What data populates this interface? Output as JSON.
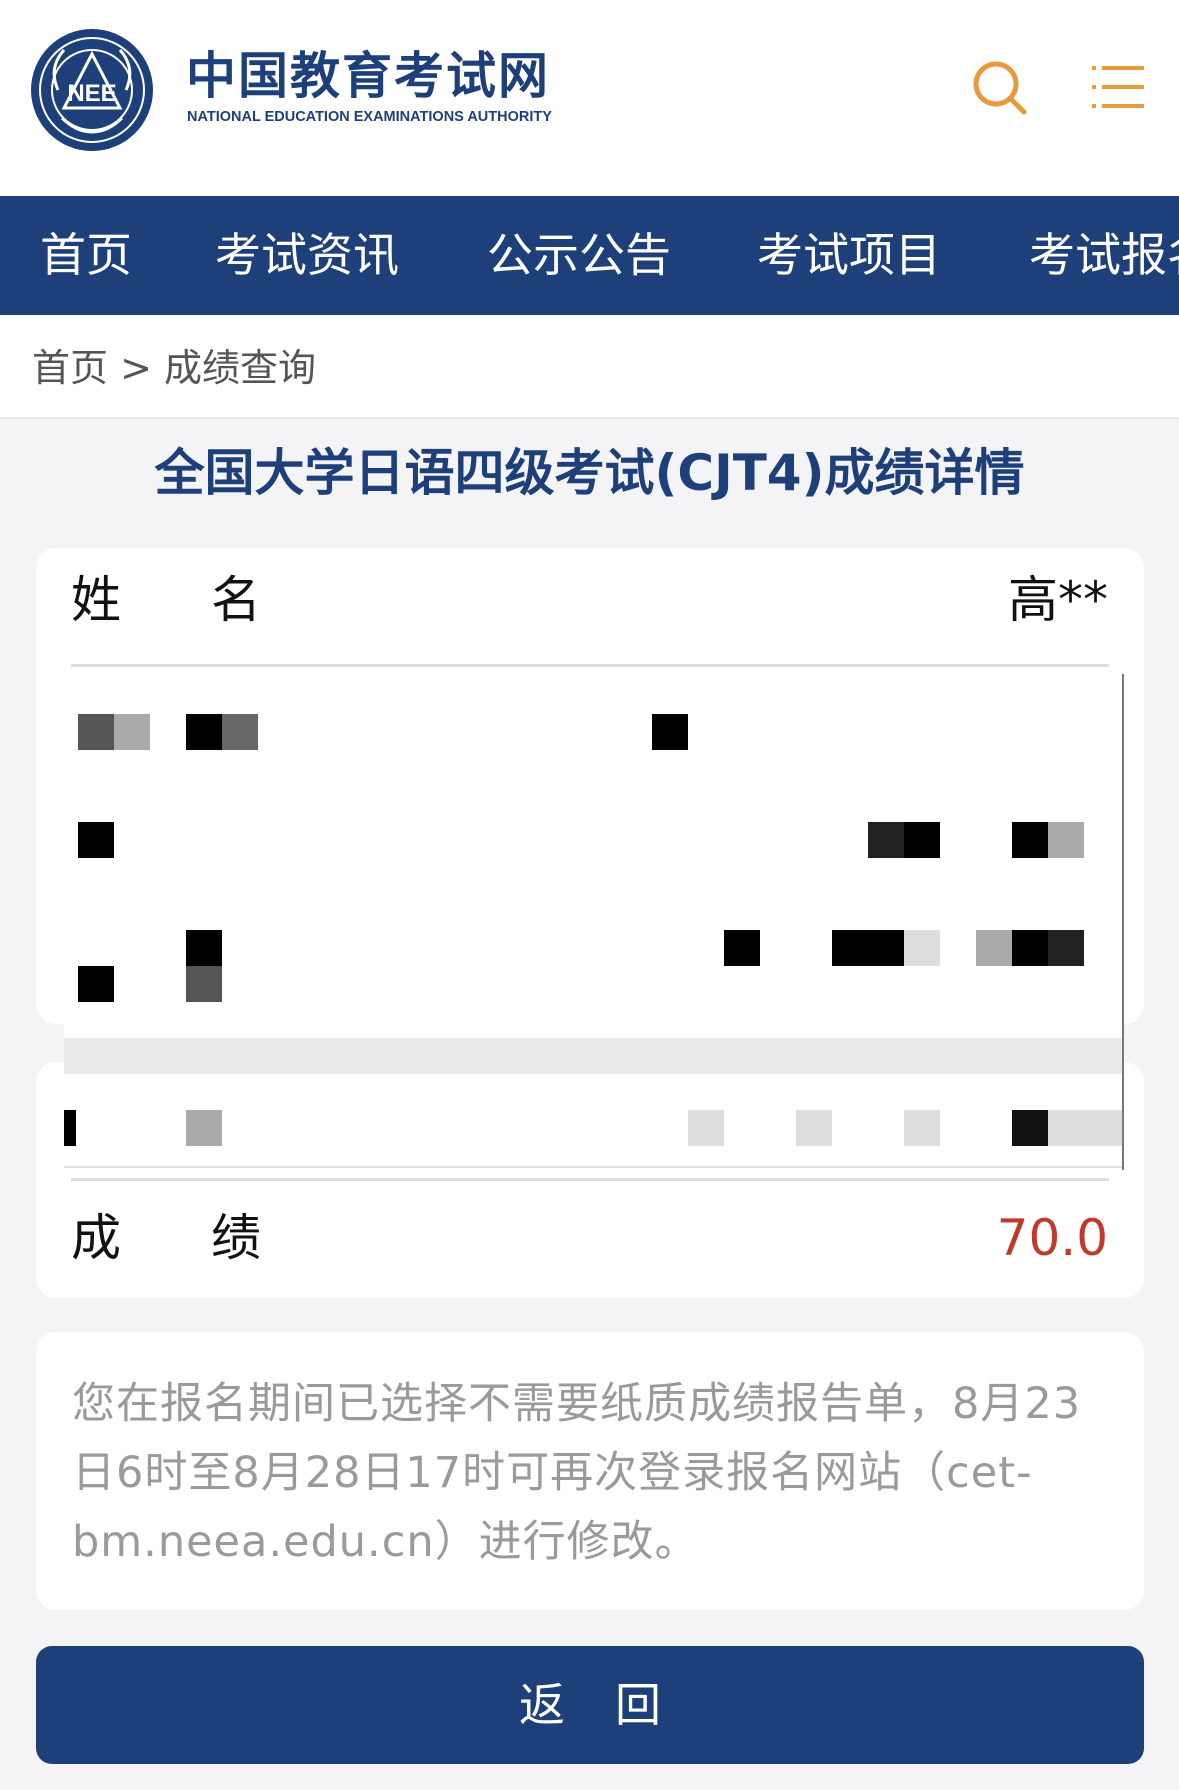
{
  "header": {
    "logo_cn": "中国教育考试网",
    "logo_en": "NATIONAL EDUCATION EXAMINATIONS AUTHORITY",
    "emblem_text": "NEE",
    "search_icon": "search-icon",
    "menu_icon": "menu-icon",
    "accent_color": "#e89a3c",
    "brand_color": "#1d3f7a"
  },
  "nav": {
    "items": [
      {
        "label": "首页"
      },
      {
        "label": "考试资讯"
      },
      {
        "label": "公示公告"
      },
      {
        "label": "考试项目"
      },
      {
        "label": "考试报名"
      }
    ]
  },
  "breadcrumb": {
    "text": "首页 > 成绩查询"
  },
  "page": {
    "title": "全国大学日语四级考试(CJT4)成绩详情"
  },
  "result": {
    "name_label": "姓名",
    "name_value": "高**",
    "score_label": "成绩",
    "score_value": "70.0",
    "score_color": "#c0392b"
  },
  "notice": {
    "text": "您在报名期间已选择不需要纸质成绩报告单，8月23日6时至8月28日17时可再次登录报名网站（cet-bm.neea.edu.cn）进行修改。"
  },
  "actions": {
    "back_label": "返回"
  }
}
